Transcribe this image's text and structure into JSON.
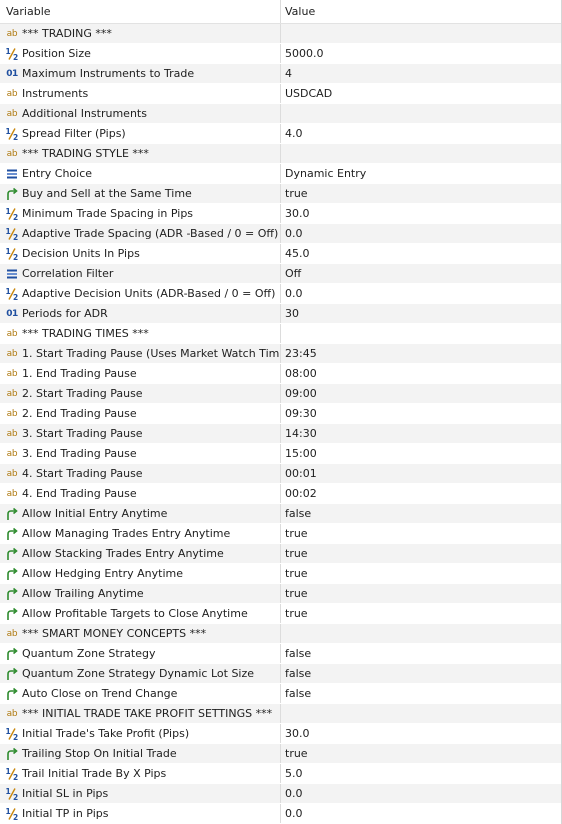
{
  "header": {
    "variable": "Variable",
    "value": "Value"
  },
  "rows": [
    {
      "icon": "ab",
      "name": "*** TRADING ***",
      "value": ""
    },
    {
      "icon": "half",
      "name": "Position Size",
      "value": "5000.0"
    },
    {
      "icon": "01",
      "name": "Maximum Instruments to Trade",
      "value": "4"
    },
    {
      "icon": "ab",
      "name": "Instruments",
      "value": "USDCAD"
    },
    {
      "icon": "ab",
      "name": "Additional Instruments",
      "value": ""
    },
    {
      "icon": "half",
      "name": "Spread Filter (Pips)",
      "value": "4.0"
    },
    {
      "icon": "ab",
      "name": "*** TRADING STYLE ***",
      "value": ""
    },
    {
      "icon": "list",
      "name": "Entry Choice",
      "value": "Dynamic Entry"
    },
    {
      "icon": "bool",
      "name": "Buy and Sell at the Same Time",
      "value": "true"
    },
    {
      "icon": "half",
      "name": "Minimum Trade Spacing in Pips",
      "value": "30.0"
    },
    {
      "icon": "half",
      "name": "Adaptive Trade Spacing (ADR -Based / 0 = Off)",
      "value": "0.0"
    },
    {
      "icon": "half",
      "name": "Decision Units In Pips",
      "value": "45.0"
    },
    {
      "icon": "list",
      "name": "Correlation Filter",
      "value": "Off"
    },
    {
      "icon": "half",
      "name": "Adaptive Decision Units (ADR-Based / 0 = Off)",
      "value": "0.0"
    },
    {
      "icon": "01",
      "name": "Periods for ADR",
      "value": "30"
    },
    {
      "icon": "ab",
      "name": "*** TRADING TIMES ***",
      "value": ""
    },
    {
      "icon": "ab",
      "name": "1. Start Trading Pause (Uses Market Watch Time)",
      "value": "23:45"
    },
    {
      "icon": "ab",
      "name": "1. End Trading Pause",
      "value": "08:00"
    },
    {
      "icon": "ab",
      "name": "2. Start Trading Pause",
      "value": "09:00"
    },
    {
      "icon": "ab",
      "name": "2. End Trading Pause",
      "value": "09:30"
    },
    {
      "icon": "ab",
      "name": "3. Start Trading Pause",
      "value": "14:30"
    },
    {
      "icon": "ab",
      "name": "3. End Trading Pause",
      "value": "15:00"
    },
    {
      "icon": "ab",
      "name": "4. Start Trading Pause",
      "value": "00:01"
    },
    {
      "icon": "ab",
      "name": "4. End Trading Pause",
      "value": "00:02"
    },
    {
      "icon": "bool",
      "name": "Allow Initial Entry Anytime",
      "value": "false"
    },
    {
      "icon": "bool",
      "name": "Allow Managing Trades Entry Anytime",
      "value": "true"
    },
    {
      "icon": "bool",
      "name": "Allow Stacking Trades Entry Anytime",
      "value": "true"
    },
    {
      "icon": "bool",
      "name": "Allow Hedging Entry Anytime",
      "value": "true"
    },
    {
      "icon": "bool",
      "name": "Allow Trailing Anytime",
      "value": "true"
    },
    {
      "icon": "bool",
      "name": "Allow Profitable Targets to Close Anytime",
      "value": "true"
    },
    {
      "icon": "ab",
      "name": "*** SMART MONEY CONCEPTS ***",
      "value": ""
    },
    {
      "icon": "bool",
      "name": "Quantum Zone Strategy",
      "value": "false"
    },
    {
      "icon": "bool",
      "name": "Quantum Zone Strategy Dynamic Lot Size",
      "value": "false"
    },
    {
      "icon": "bool",
      "name": "Auto Close on Trend Change",
      "value": "false"
    },
    {
      "icon": "ab",
      "name": "*** INITIAL TRADE TAKE PROFIT SETTINGS ***",
      "value": ""
    },
    {
      "icon": "half",
      "name": "Initial Trade's Take Profit (Pips)",
      "value": "30.0"
    },
    {
      "icon": "bool",
      "name": "Trailing Stop On Initial Trade",
      "value": "true"
    },
    {
      "icon": "half",
      "name": "Trail Initial Trade By X Pips",
      "value": "5.0"
    },
    {
      "icon": "half",
      "name": "Initial SL in Pips",
      "value": "0.0"
    },
    {
      "icon": "half",
      "name": "Initial TP in Pips",
      "value": "0.0"
    }
  ]
}
